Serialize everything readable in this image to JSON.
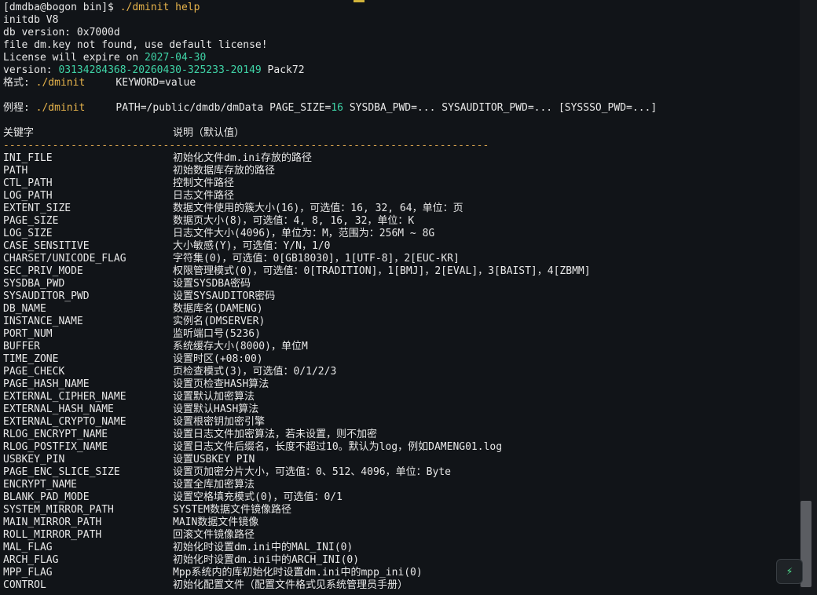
{
  "header": {
    "prompt": "[dmdba@bogon bin]$ ",
    "command": "./dminit help",
    "l2": "initdb V8",
    "l3": "db version: 0x7000d",
    "l4": "file dm.key not found, use default license!",
    "l5a": "License will expire on ",
    "l5b": "2027-04-30",
    "l6a": "version: ",
    "l6b": "03134284368-20260430-325233-20149",
    "l6c": " Pack72",
    "l7a": "格式: ",
    "l7b": "./dminit",
    "l7c": "     KEYWORD=value",
    "l8a": "例程: ",
    "l8b": "./dminit",
    "l8c": "     PATH=/public/dmdb/dmData PAGE_SIZE=",
    "l8d": "16",
    "l8e": " SYSDBA_PWD=... SYSAUDITOR_PWD=... [SYSSSO_PWD=...]",
    "col_keyword": "关键字",
    "col_desc": "说明（默认值）",
    "divider": "-------------------------------------------------------------------------------"
  },
  "rows": [
    {
      "k": "INI_FILE",
      "d": "初始化文件dm.ini存放的路径"
    },
    {
      "k": "PATH",
      "d": "初始数据库存放的路径"
    },
    {
      "k": "CTL_PATH",
      "d": "控制文件路径"
    },
    {
      "k": "LOG_PATH",
      "d": "日志文件路径"
    },
    {
      "k": "EXTENT_SIZE",
      "d": "数据文件使用的簇大小(16)，可选值：16, 32, 64，单位：页"
    },
    {
      "k": "PAGE_SIZE",
      "d": "数据页大小(8)，可选值：4, 8, 16, 32，单位：K"
    },
    {
      "k": "LOG_SIZE",
      "d": "日志文件大小(4096)，单位为：M，范围为：256M ~ 8G"
    },
    {
      "k": "CASE_SENSITIVE",
      "d": "大小敏感(Y)，可选值：Y/N，1/0"
    },
    {
      "k": "CHARSET/UNICODE_FLAG",
      "d": "字符集(0)，可选值：0[GB18030]，1[UTF-8]，2[EUC-KR]"
    },
    {
      "k": "SEC_PRIV_MODE",
      "d": "权限管理模式(0)，可选值：0[TRADITION]，1[BMJ]，2[EVAL]，3[BAIST]，4[ZBMM]"
    },
    {
      "k": "SYSDBA_PWD",
      "d": "设置SYSDBA密码"
    },
    {
      "k": "SYSAUDITOR_PWD",
      "d": "设置SYSAUDITOR密码"
    },
    {
      "k": "DB_NAME",
      "d": "数据库名(DAMENG)"
    },
    {
      "k": "INSTANCE_NAME",
      "d": "实例名(DMSERVER)"
    },
    {
      "k": "PORT_NUM",
      "d": "监听端口号(5236)"
    },
    {
      "k": "BUFFER",
      "d": "系统缓存大小(8000)，单位M"
    },
    {
      "k": "TIME_ZONE",
      "d": "设置时区(+08:00)"
    },
    {
      "k": "PAGE_CHECK",
      "d": "页检查模式(3)，可选值：0/1/2/3"
    },
    {
      "k": "PAGE_HASH_NAME",
      "d": "设置页检查HASH算法"
    },
    {
      "k": "EXTERNAL_CIPHER_NAME",
      "d": "设置默认加密算法"
    },
    {
      "k": "EXTERNAL_HASH_NAME",
      "d": "设置默认HASH算法"
    },
    {
      "k": "EXTERNAL_CRYPTO_NAME",
      "d": "设置根密钥加密引擎"
    },
    {
      "k": "RLOG_ENCRYPT_NAME",
      "d": "设置日志文件加密算法，若未设置，则不加密"
    },
    {
      "k": "RLOG_POSTFIX_NAME",
      "d": "设置日志文件后缀名，长度不超过10。默认为log，例如DAMENG01.log"
    },
    {
      "k": "USBKEY_PIN",
      "d": "设置USBKEY PIN"
    },
    {
      "k": "PAGE_ENC_SLICE_SIZE",
      "d": "设置页加密分片大小，可选值：0、512、4096，单位：Byte"
    },
    {
      "k": "ENCRYPT_NAME",
      "d": "设置全库加密算法"
    },
    {
      "k": "BLANK_PAD_MODE",
      "d": "设置空格填充模式(0)，可选值：0/1"
    },
    {
      "k": "SYSTEM_MIRROR_PATH",
      "d": "SYSTEM数据文件镜像路径"
    },
    {
      "k": "MAIN_MIRROR_PATH",
      "d": "MAIN数据文件镜像"
    },
    {
      "k": "ROLL_MIRROR_PATH",
      "d": "回滚文件镜像路径"
    },
    {
      "k": "MAL_FLAG",
      "d": "初始化时设置dm.ini中的MAL_INI(0)"
    },
    {
      "k": "ARCH_FLAG",
      "d": "初始化时设置dm.ini中的ARCH_INI(0)"
    },
    {
      "k": "MPP_FLAG",
      "d": "Mpp系统内的库初始化时设置dm.ini中的mpp_ini(0)"
    },
    {
      "k": "CONTROL",
      "d": "初始化配置文件（配置文件格式见系统管理员手册）"
    }
  ],
  "fab_icon": "lightning-icon",
  "fab_glyph": "⚡"
}
